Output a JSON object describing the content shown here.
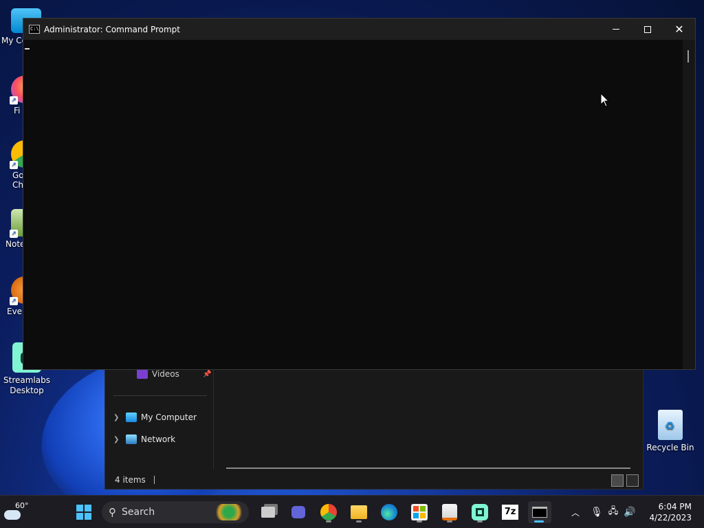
{
  "desktop": {
    "icons": [
      {
        "label": "My Co",
        "name": "my-computer"
      },
      {
        "label": "Fi",
        "name": "firefox"
      },
      {
        "label": "Go\nChi",
        "name": "google-chrome"
      },
      {
        "label": "Note",
        "name": "notepad"
      },
      {
        "label": "Ever",
        "name": "evernote"
      },
      {
        "label": "Streamlabs Desktop",
        "name": "streamlabs-desktop"
      },
      {
        "label": "Recycle Bin",
        "name": "recycle-bin"
      }
    ]
  },
  "explorer": {
    "nav": {
      "videos": "Videos",
      "my_computer": "My Computer",
      "network": "Network"
    },
    "status": {
      "items": "4 items"
    }
  },
  "cmd": {
    "title": "Administrator:  Command Prompt",
    "icon_text": "C:\\"
  },
  "taskbar": {
    "weather_temp": "60°",
    "search_label": "Search",
    "seven_zip": "7z",
    "clock_time": "6:04 PM",
    "clock_date": "4/22/2023"
  },
  "colors": {
    "accent": "#4cc2ff",
    "console_bg": "#0c0c0c",
    "titlebar_bg": "#1f1f1f",
    "taskbar_bg": "#1c1c22"
  }
}
